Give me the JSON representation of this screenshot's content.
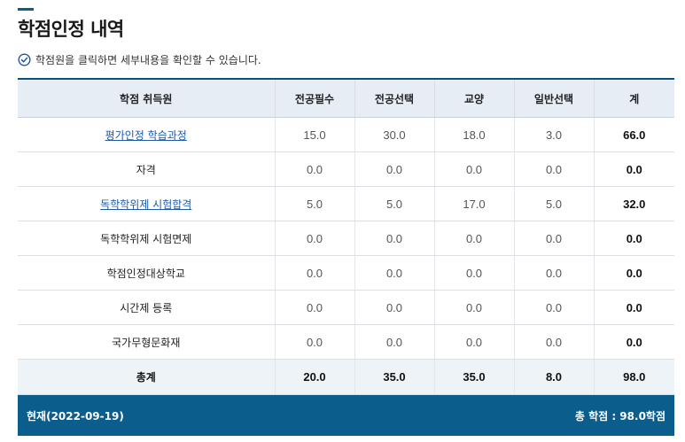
{
  "page": {
    "title": "학점인정 내역",
    "notice": "학점원을 클릭하면 세부내용을 확인할 수 있습니다."
  },
  "table": {
    "headers": [
      "학점 취득원",
      "전공필수",
      "전공선택",
      "교양",
      "일반선택",
      "계"
    ],
    "rows": [
      {
        "source": "평가인정 학습과정",
        "linked": true,
        "values": [
          "15.0",
          "30.0",
          "18.0",
          "3.0"
        ],
        "total": "66.0"
      },
      {
        "source": "자격",
        "linked": false,
        "values": [
          "0.0",
          "0.0",
          "0.0",
          "0.0"
        ],
        "total": "0.0"
      },
      {
        "source": "독학학위제 시험합격",
        "linked": true,
        "values": [
          "5.0",
          "5.0",
          "17.0",
          "5.0"
        ],
        "total": "32.0"
      },
      {
        "source": "독학학위제 시험면제",
        "linked": false,
        "values": [
          "0.0",
          "0.0",
          "0.0",
          "0.0"
        ],
        "total": "0.0"
      },
      {
        "source": "학점인정대상학교",
        "linked": false,
        "values": [
          "0.0",
          "0.0",
          "0.0",
          "0.0"
        ],
        "total": "0.0"
      },
      {
        "source": "시간제 등록",
        "linked": false,
        "values": [
          "0.0",
          "0.0",
          "0.0",
          "0.0"
        ],
        "total": "0.0"
      },
      {
        "source": "국가무형문화재",
        "linked": false,
        "values": [
          "0.0",
          "0.0",
          "0.0",
          "0.0"
        ],
        "total": "0.0"
      }
    ],
    "sum": {
      "label": "총계",
      "values": [
        "20.0",
        "35.0",
        "35.0",
        "8.0"
      ],
      "total": "98.0"
    }
  },
  "footer": {
    "date_label": "현재(2022-09-19)",
    "total_label": "총 학점 : 98.0학점"
  },
  "colors": {
    "accent": "#0b5d8c",
    "link": "#1e5aa8",
    "header_bg": "#e7edf4"
  },
  "icons": {
    "notice": "check-circle-icon"
  }
}
